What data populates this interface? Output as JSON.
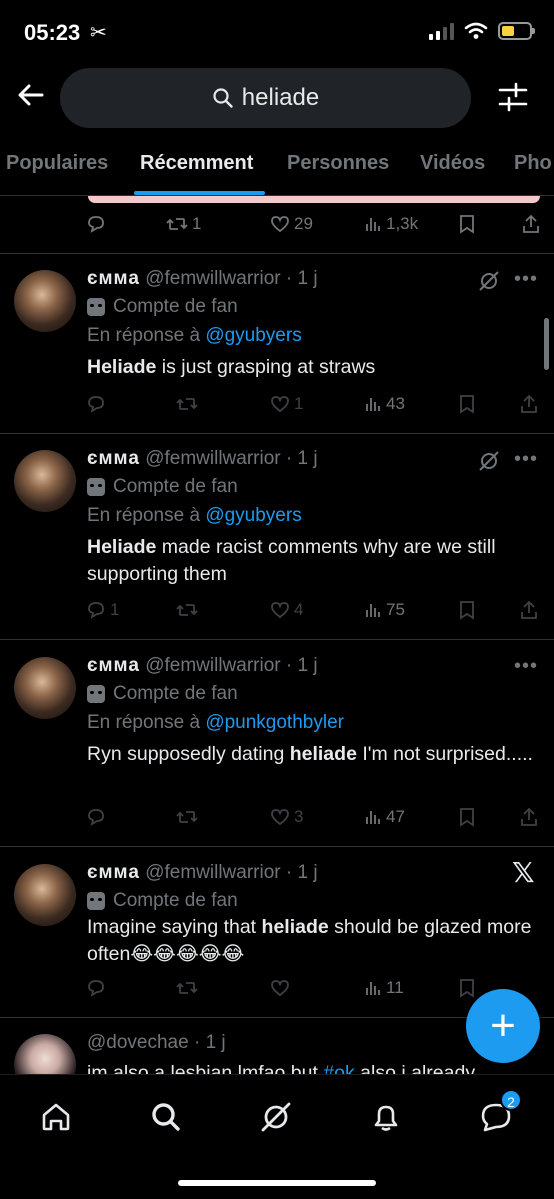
{
  "status_bar": {
    "time": "05:23",
    "scissors": "✂"
  },
  "search": {
    "query": "heliade"
  },
  "tabs": [
    {
      "label": "Populaires"
    },
    {
      "label": "Récemment"
    },
    {
      "label": "Personnes"
    },
    {
      "label": "Vidéos"
    },
    {
      "label": "Pho"
    }
  ],
  "top_post": {
    "retweets": "1",
    "likes": "29",
    "views": "1,3k"
  },
  "tweets": [
    {
      "name": "ємма",
      "handle": "@femwillwarrior · 1 j",
      "fan_label": "Compte de fan",
      "reply_prefix": "En réponse à ",
      "reply_to": "@gyubyers",
      "text_bold": "Heliade",
      "text_rest": " is just grasping at straws",
      "likes": "1",
      "views": "43"
    },
    {
      "name": "ємма",
      "handle": "@femwillwarrior · 1 j",
      "fan_label": "Compte de fan",
      "reply_prefix": "En réponse à ",
      "reply_to": "@gyubyers",
      "text_bold": "Heliade",
      "text_rest": " made racist comments why are we still supporting them",
      "replies": "1",
      "likes": "4",
      "views": "75"
    },
    {
      "name": "ємма",
      "handle": "@femwillwarrior · 1 j",
      "fan_label": "Compte de fan",
      "reply_prefix": "En réponse à ",
      "reply_to": "@punkgothbyler",
      "text_pre": "Ryn supposedly dating ",
      "text_bold": "heliade",
      "text_rest": " I'm not surprised.....",
      "likes": "3",
      "views": "47"
    },
    {
      "name": "ємма",
      "handle": "@femwillwarrior · 1 j",
      "fan_label": "Compte de fan",
      "text_pre": "Imagine saying that ",
      "text_bold": "heliade",
      "text_rest": " should be glazed more often😂😂😂😂😂",
      "views": "11"
    },
    {
      "handle": "@dovechae · 1 j",
      "text_pre": "im also a lesbian lmfao but ",
      "hashtag": "#ok",
      "text_rest": " also i already"
    }
  ],
  "bottom_nav": {
    "messages_badge": "2"
  },
  "fab": {
    "label": "+"
  },
  "icons": [
    "back-arrow-icon",
    "search-icon",
    "filter-sliders-icon",
    "reply-icon",
    "retweet-icon",
    "like-icon",
    "views-icon",
    "bookmark-icon",
    "share-icon",
    "grok-icon",
    "more-icon",
    "x-logo-icon",
    "home-icon",
    "explore-icon",
    "grok-nav-icon",
    "notifications-icon",
    "messages-icon"
  ],
  "colors": {
    "accent": "#1d9bf0",
    "background": "#000000",
    "muted": "#71767b",
    "text": "#e7e9ea"
  }
}
